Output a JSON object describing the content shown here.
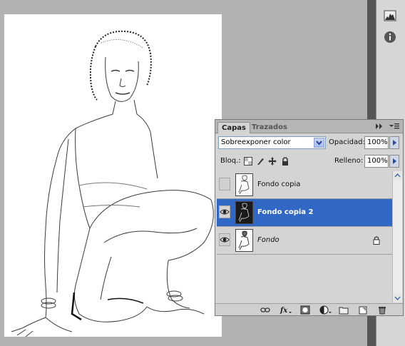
{
  "layers_panel": {
    "tabs": [
      "Capas",
      "Trazados"
    ],
    "blend_mode": "Sobreexponer color",
    "opacity_label": "Opacidad:",
    "opacity_value": "100%",
    "lock_label": "Bloq.:",
    "fill_label": "Relleno:",
    "fill_value": "100%",
    "layers": [
      {
        "name": "Fondo copia",
        "visible": false,
        "selected": false,
        "locked": false,
        "italic": false
      },
      {
        "name": "Fondo copia 2",
        "visible": true,
        "selected": true,
        "locked": false,
        "italic": false
      },
      {
        "name": "Fondo",
        "visible": true,
        "selected": false,
        "locked": true,
        "italic": true
      }
    ],
    "footer_icons": [
      "link-icon",
      "fx-icon",
      "mask-icon",
      "adjustment-icon",
      "folder-icon",
      "new-layer-icon",
      "trash-icon"
    ]
  },
  "dock": {
    "icons": [
      "histogram-icon",
      "info-icon"
    ]
  },
  "colors": {
    "workspace": "#b2b2b2",
    "panel": "#d4d4d4",
    "selection": "#3168c5"
  }
}
